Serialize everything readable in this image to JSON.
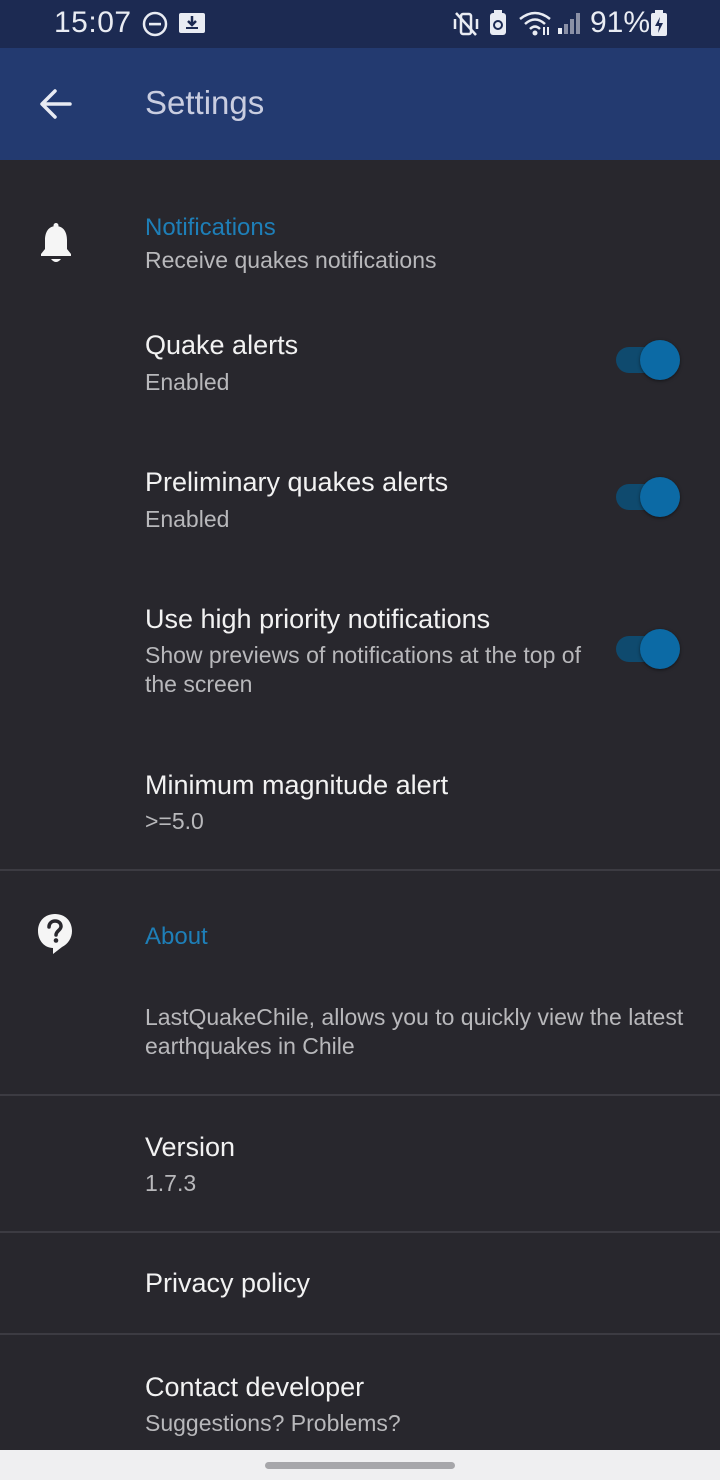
{
  "status_bar": {
    "time": "15:07",
    "battery_percent": "91%",
    "icons": [
      "do-not-disturb-icon",
      "download-icon",
      "mute-vibrate-icon",
      "battery-saver-icon",
      "wifi-icon",
      "cell-signal-icon",
      "battery-charging-icon"
    ]
  },
  "app_bar": {
    "title": "Settings",
    "back_icon": "arrow-back-icon",
    "background": "#233a70"
  },
  "notifications": {
    "icon": "bell-icon",
    "category_title": "Notifications",
    "category_summary": "Receive quakes notifications",
    "quake_alerts": {
      "title": "Quake alerts",
      "summary": "Enabled",
      "enabled": true
    },
    "preliminary_alerts": {
      "title": "Preliminary quakes alerts",
      "summary": "Enabled",
      "enabled": true
    },
    "high_priority": {
      "title": "Use high priority notifications",
      "summary": "Show previews of notifications at the top of the screen",
      "enabled": true
    },
    "min_magnitude": {
      "title": "Minimum magnitude alert",
      "summary": ">=5.0"
    }
  },
  "about": {
    "icon": "help-circle-icon",
    "category_title": "About",
    "description": "LastQuakeChile, allows you to quickly view the latest earthquakes in Chile",
    "version": {
      "title": "Version",
      "summary": "1.7.3"
    },
    "privacy": {
      "title": "Privacy policy"
    },
    "contact": {
      "title": "Contact developer",
      "summary": "Suggestions? Problems?"
    }
  },
  "colors": {
    "accent": "#1e7fb8",
    "switch_thumb": "#0c6aa5",
    "background": "#28272d"
  }
}
